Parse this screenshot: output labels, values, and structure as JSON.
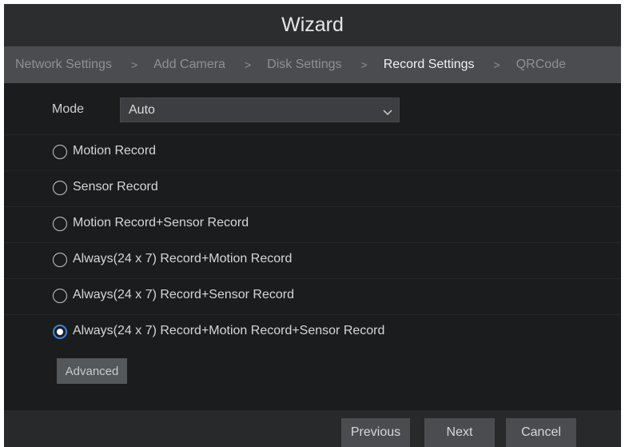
{
  "window": {
    "title": "Wizard"
  },
  "steps": [
    {
      "label": "Network Settings",
      "active": false
    },
    {
      "label": "Add Camera",
      "active": false
    },
    {
      "label": "Disk Settings",
      "active": false
    },
    {
      "label": "Record Settings",
      "active": true
    },
    {
      "label": "QRCode",
      "active": false
    }
  ],
  "step_separator": ">",
  "mode": {
    "label": "Mode",
    "value": "Auto",
    "icon": "chevron-down-icon"
  },
  "record_options": [
    {
      "label": "Motion Record",
      "selected": false
    },
    {
      "label": "Sensor Record",
      "selected": false
    },
    {
      "label": "Motion Record+Sensor Record",
      "selected": false
    },
    {
      "label": "Always(24 x 7) Record+Motion Record",
      "selected": false
    },
    {
      "label": "Always(24 x 7) Record+Sensor Record",
      "selected": false
    },
    {
      "label": "Always(24 x 7) Record+Motion Record+Sensor Record",
      "selected": true
    }
  ],
  "advanced_label": "Advanced",
  "footer": {
    "previous_label": "Previous",
    "next_label": "Next",
    "cancel_label": "Cancel"
  },
  "colors": {
    "background": "#1b1c1e",
    "title_bar": "#2b2d2f",
    "steps_bar": "#4a4c4f",
    "active_step": "#f2f2f2",
    "inactive_step": "#8e9195",
    "radio_selected": "#3a86d8"
  }
}
